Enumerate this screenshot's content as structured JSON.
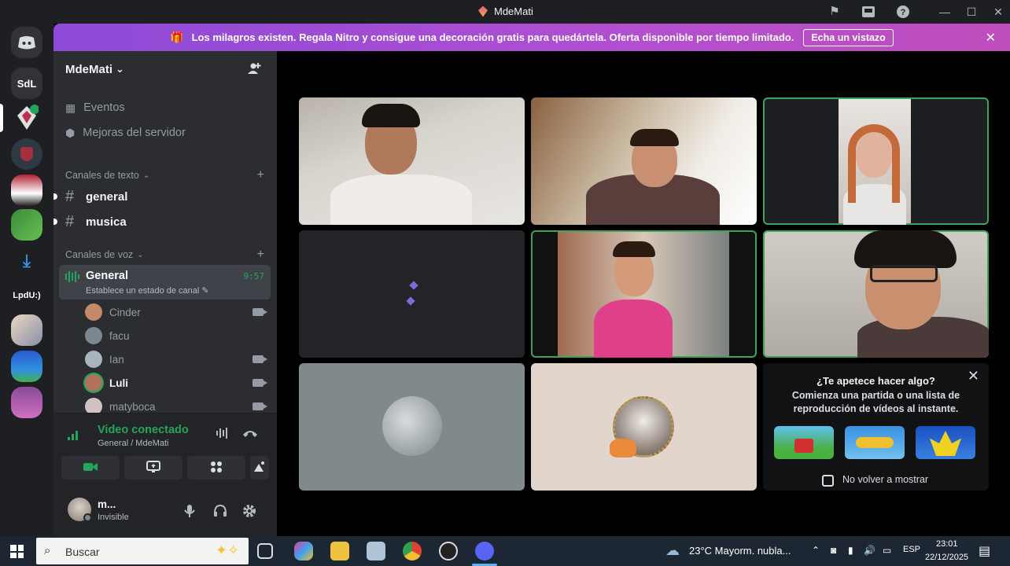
{
  "window": {
    "title": "MdeMati"
  },
  "titlebar_icons": [
    "flag-icon",
    "inbox-icon",
    "help-icon"
  ],
  "window_controls": {
    "minimize": "—",
    "maximize": "☐",
    "close": "✕"
  },
  "rail": {
    "home_icon": "discord-logo-icon",
    "servers": [
      {
        "label": "SdL"
      },
      {
        "label": "LpdU:)"
      }
    ]
  },
  "banner": {
    "text": "Los milagros existen. Regala Nitro y consigue una decoración gratis para quedártela. Oferta disponible por tiempo limitado.",
    "button": "Echa un vistazo",
    "gift_icon": "gift-icon"
  },
  "server": {
    "name": "MdeMati",
    "chevron": "⌄",
    "items": [
      {
        "label": "Eventos",
        "icon": "calendar-icon"
      },
      {
        "label": "Mejoras del servidor",
        "icon": "boost-icon"
      }
    ],
    "text_category": {
      "label": "Canales de texto",
      "chevron": "⌄"
    },
    "text_channels": [
      {
        "name": "general"
      },
      {
        "name": "musica"
      }
    ],
    "voice_category": {
      "label": "Canales de voz",
      "chevron": "⌄"
    },
    "voice_channel": {
      "name": "General",
      "status": "Establece un estado de canal",
      "timer": "9:57"
    },
    "voice_users": [
      {
        "name": "Cinder",
        "camera": true,
        "speaking": false,
        "avatar_color": "#c48a6a"
      },
      {
        "name": "facu",
        "camera": false,
        "speaking": false,
        "avatar_color": "#7d8790"
      },
      {
        "name": "Ian",
        "camera": true,
        "speaking": false,
        "avatar_color": "#a9b4bc"
      },
      {
        "name": "Luli",
        "camera": true,
        "speaking": true,
        "avatar_color": "#b0725a"
      },
      {
        "name": "matyboca",
        "camera": true,
        "speaking": false,
        "avatar_color": "#d2c2c4"
      }
    ]
  },
  "voice_connection": {
    "title": "Video conectado",
    "subtitle": "General / MdeMati"
  },
  "user": {
    "name": "m...",
    "status": "Invisible"
  },
  "activity_card": {
    "title": "¿Te apetece hacer algo?",
    "body": "Comienza una partida o una lista de reproducción de vídeos al instante.",
    "checkbox_label": "No volver a mostrar",
    "checked": false
  },
  "taskbar": {
    "search_placeholder": "Buscar",
    "weather": "23°C  Mayorm. nubla...",
    "language": "ESP",
    "time": "23:01",
    "date": "22/12/2025"
  },
  "colors": {
    "speaking_green": "#3ba55c",
    "banner_purple": "#8c4bd8",
    "sidebar_bg": "#2b2d31"
  }
}
